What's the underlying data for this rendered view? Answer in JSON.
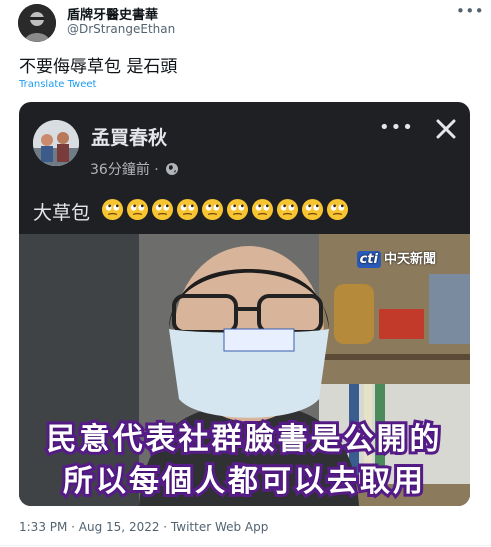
{
  "author": {
    "display_name": "盾牌牙醫史書華",
    "handle": "@DrStrangeEthan"
  },
  "tweet": {
    "text": "不要侮辱草包 是石頭",
    "translate_label": "Translate Tweet",
    "timestamp": "1:33 PM · Aug 15, 2022 · Twitter Web App"
  },
  "icons": {
    "more": "more-horizontal-icon",
    "close": "close-icon",
    "globe": "globe-icon",
    "emoji": "face-with-rolling-eyes"
  },
  "embedded_post": {
    "name": "孟買春秋",
    "time": "36分鐘前 ·",
    "text": "大草包",
    "emoji_count": 10,
    "video_logo": "中天新聞",
    "video_logo_badge": "cti",
    "caption_line1": "民意代表社群臉書是公開的",
    "caption_line2": "所以每個人都可以去取用"
  },
  "colors": {
    "link": "#1d9bf0",
    "secondary": "#536471",
    "card_bg": "#1f2023",
    "caption_stroke": "#5a1e8c"
  }
}
